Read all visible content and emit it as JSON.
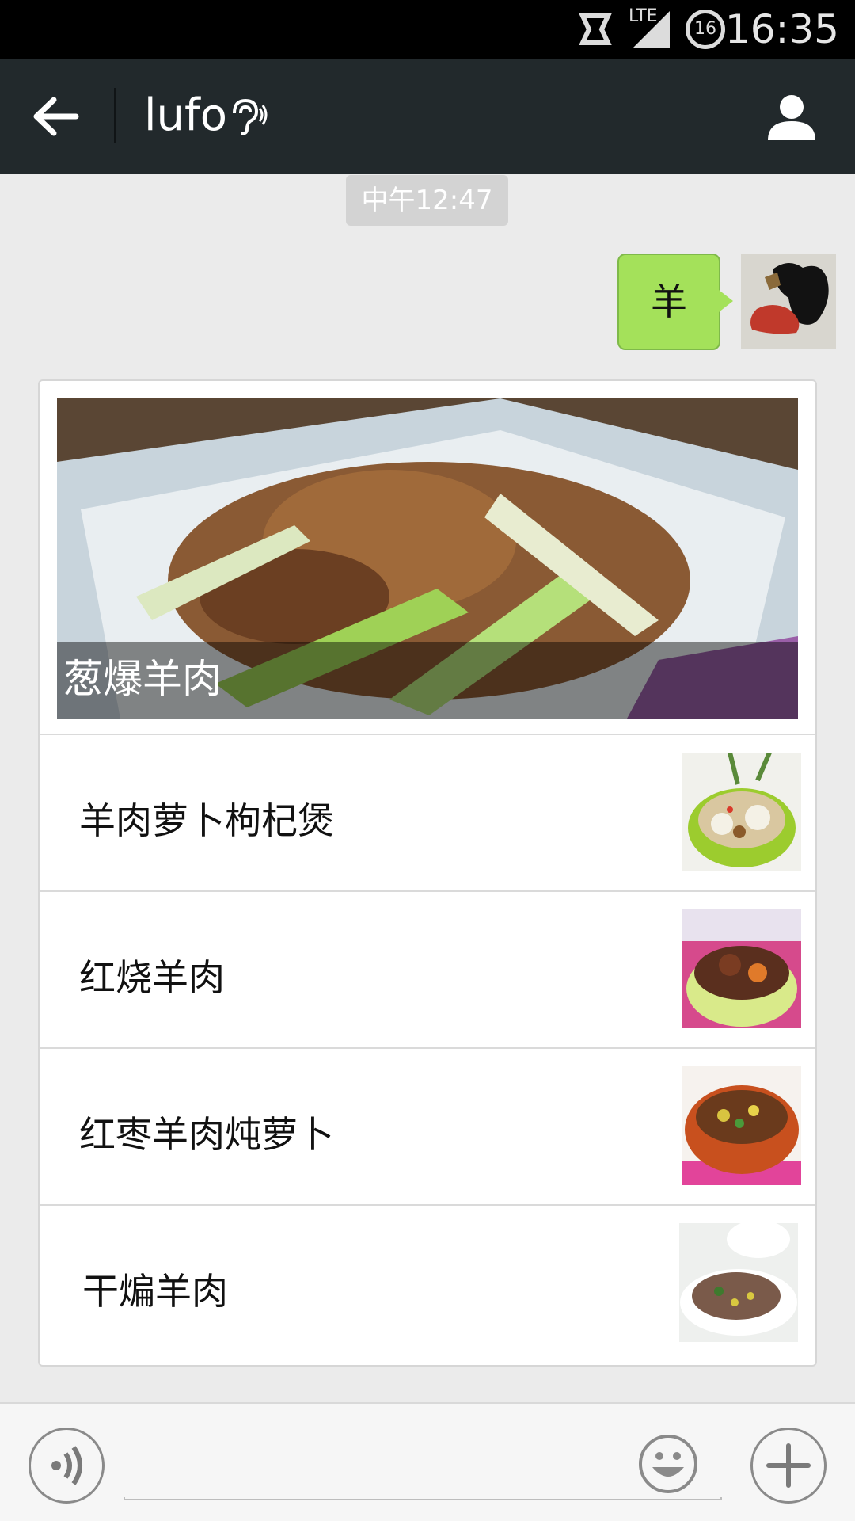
{
  "status_bar": {
    "time": "16:35",
    "network": "LTE",
    "notification_count": "16",
    "icons": [
      "sync-icon",
      "signal-icon",
      "notification-icon"
    ]
  },
  "header": {
    "back_icon": "arrow-left-icon",
    "title": "lufo",
    "ear_icon": "earpiece-mode-icon",
    "profile_icon": "person-icon"
  },
  "chat": {
    "timestamp": "中午12:47",
    "sent_message": "羊",
    "recipe_card": {
      "hero_title": "葱爆羊肉",
      "items": [
        {
          "label": "羊肉萝卜枸杞煲"
        },
        {
          "label": "红烧羊肉"
        },
        {
          "label": "红枣羊肉炖萝卜"
        },
        {
          "label": "干煸羊肉"
        }
      ]
    }
  },
  "input_bar": {
    "voice_icon": "voice-input-icon",
    "emoji_icon": "emoji-icon",
    "plus_icon": "plus-icon",
    "value": ""
  },
  "colors": {
    "header_bg": "#22292c",
    "bubble_green": "#a4e15a",
    "chat_bg": "#ebebeb"
  }
}
